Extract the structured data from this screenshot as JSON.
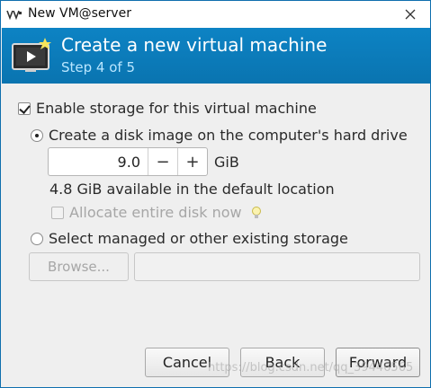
{
  "window": {
    "title": "New VM@server"
  },
  "header": {
    "title": "Create a new virtual machine",
    "step": "Step 4 of 5"
  },
  "storage": {
    "enable_label": "Enable storage for this virtual machine",
    "enable_checked": true,
    "create_disk_label": "Create a disk image on the computer's hard drive",
    "create_disk_selected": true,
    "size_value": "9.0",
    "decrement_label": "−",
    "increment_label": "+",
    "unit": "GiB",
    "available_text": "4.8 GiB available in the default location",
    "allocate_label": "Allocate entire disk now",
    "allocate_checked": false,
    "managed_label": "Select managed or other existing storage",
    "managed_selected": false,
    "browse_label": "Browse...",
    "path_value": ""
  },
  "buttons": {
    "cancel": "Cancel",
    "back": "Back",
    "forward": "Forward"
  },
  "watermark": "https://blog.csdn.net/qq_39446565",
  "colors": {
    "banner": "#0c7cba",
    "banner_step": "#b9e6ff"
  },
  "icons": {
    "app": "vm-manager-icon",
    "header": "vm-screen-icon",
    "close": "close-icon",
    "hint": "lightbulb-icon"
  }
}
